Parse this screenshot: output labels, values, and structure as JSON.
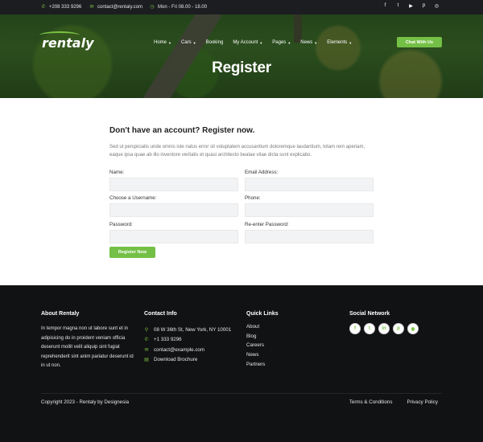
{
  "topbar": {
    "phone": "+208 333 9296",
    "email": "contact@rentaly.com",
    "hours": "Mon - Fri 08.00 - 18.00",
    "social": [
      {
        "icon": "facebook-icon",
        "glyph": "f"
      },
      {
        "icon": "twitter-icon",
        "glyph": "t"
      },
      {
        "icon": "youtube-icon",
        "glyph": "▶"
      },
      {
        "icon": "pinterest-icon",
        "glyph": "p"
      },
      {
        "icon": "instagram-icon",
        "glyph": "◎"
      }
    ]
  },
  "header": {
    "logo": "rentaly",
    "nav": [
      {
        "label": "Home",
        "caret": true
      },
      {
        "label": "Cars",
        "caret": true
      },
      {
        "label": "Booking",
        "caret": false
      },
      {
        "label": "My Account",
        "caret": true
      },
      {
        "label": "Pages",
        "caret": true
      },
      {
        "label": "News",
        "caret": true
      },
      {
        "label": "Elements",
        "caret": true
      }
    ],
    "cta": "Chat With Us",
    "page_title": "Register"
  },
  "form": {
    "heading": "Don't have an account? Register now.",
    "intro": "Sed ut perspiciatis unde omnis iste natus error sit voluptatem accusantium doloremque laudantium, totam rem aperiam, eaque ipsa quae ab illo inventore veritatis et quasi architecto beatae vitae dicta sunt explicabo.",
    "fields": {
      "name": "Name:",
      "email": "Email Address:",
      "username": "Choose a Username:",
      "phone": "Phone:",
      "password": "Password:",
      "reenter": "Re-enter Password:"
    },
    "submit": "Register Now"
  },
  "footer": {
    "about": {
      "title": "About Rentaly",
      "text": "In tempor magna non ut labore sunt et in adipisicing do in proident veniam officia deserunt mollit velit aliquip sint fugiat reprehenderit sint anim pariatur deserunt id in ut non."
    },
    "contact": {
      "title": "Contact Info",
      "address": "08 W 36th St, New York, NY 10001",
      "phone": "+1 333 9296",
      "email": "contact@example.com",
      "brochure": "Download Brochure"
    },
    "quick_links": {
      "title": "Quick Links",
      "items": [
        "About",
        "Blog",
        "Careers",
        "News",
        "Partners"
      ]
    },
    "social": {
      "title": "Social Network",
      "items": [
        {
          "icon": "facebook-icon",
          "glyph": "f"
        },
        {
          "icon": "twitter-icon",
          "glyph": "t"
        },
        {
          "icon": "linkedin-icon",
          "glyph": "in"
        },
        {
          "icon": "pinterest-icon",
          "glyph": "p"
        },
        {
          "icon": "rss-icon",
          "glyph": "◉"
        }
      ]
    },
    "copyright": "Copyright 2023 - Rentaly by Designesia",
    "terms": "Terms & Conditions",
    "privacy": "Privacy Policy"
  },
  "colors": {
    "accent": "#74c046",
    "topbar_bg": "#1b1d20",
    "footer_bg": "#111214"
  }
}
